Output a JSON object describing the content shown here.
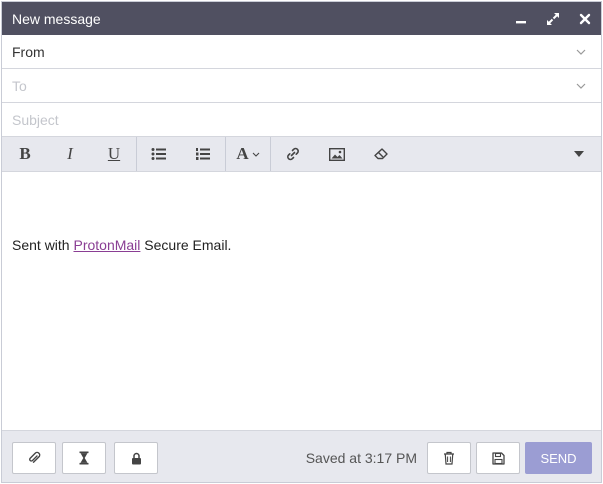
{
  "window": {
    "title": "New message"
  },
  "fields": {
    "from_label": "From",
    "to_placeholder": "To",
    "subject_placeholder": "Subject"
  },
  "editor": {
    "signature_prefix": "Sent with ",
    "signature_link": "ProtonMail",
    "signature_suffix": " Secure Email."
  },
  "toolbar": {
    "bold": "B",
    "italic": "I",
    "underline": "U",
    "font": "A",
    "icons": [
      "bold-icon",
      "italic-icon",
      "underline-icon",
      "bullet-list-icon",
      "numbered-list-icon",
      "font-icon",
      "link-icon",
      "image-icon",
      "eraser-icon",
      "more-caret-icon"
    ]
  },
  "footer": {
    "saved_text": "Saved at 3:17 PM",
    "send_label": "SEND",
    "icons": [
      "paperclip-icon",
      "hourglass-icon",
      "lock-icon",
      "trash-icon",
      "save-icon"
    ]
  },
  "colors": {
    "titlebar": "#505061",
    "toolbar_bg": "#e7e8ee",
    "send_button": "#9b9dd3",
    "link": "#8a3e94"
  }
}
